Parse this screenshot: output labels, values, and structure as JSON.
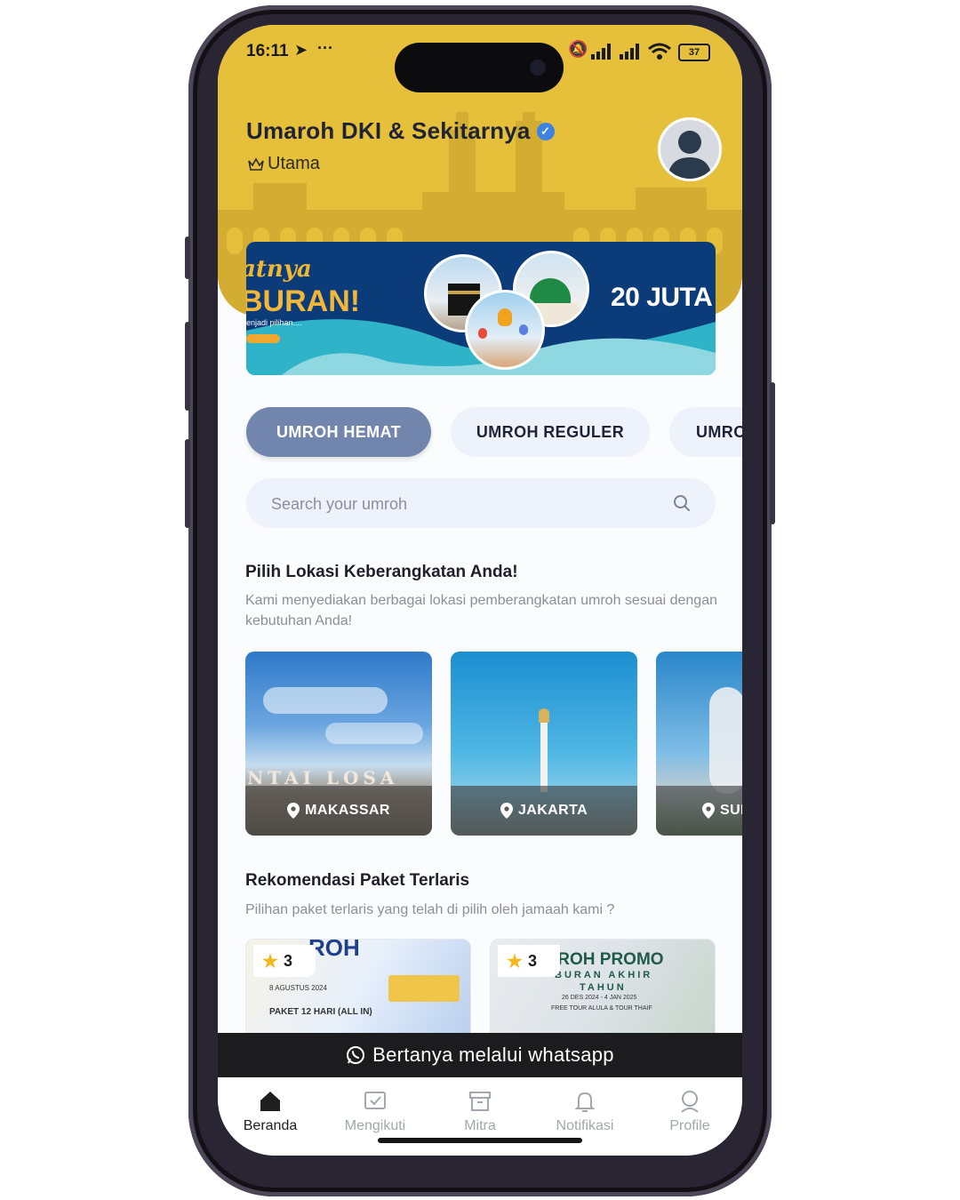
{
  "status_bar": {
    "time": "16:11",
    "battery": "37"
  },
  "header": {
    "title": "Umaroh DKI & Sekitarnya",
    "tier": "Utama"
  },
  "banner": {
    "left_script": "atnya",
    "left_big": "BURAN!",
    "left_small": "enjadi pilihan....",
    "right_text": "20 JUTA"
  },
  "tabs": [
    {
      "label": "UMROH HEMAT",
      "active": true
    },
    {
      "label": "UMROH REGULER",
      "active": false
    },
    {
      "label": "UMRO",
      "active": false
    }
  ],
  "search": {
    "placeholder": "Search your umroh"
  },
  "locations_section": {
    "title": "Pilih Lokasi Keberangkatan Anda!",
    "subtitle": "Kami menyediakan berbagai lokasi pemberangkatan umroh sesuai dengan kebutuhan Anda!",
    "items": [
      {
        "name": "MAKASSAR",
        "sign": "NTAI LOSA"
      },
      {
        "name": "JAKARTA"
      },
      {
        "name": "SUI"
      }
    ]
  },
  "packages_section": {
    "title": "Rekomendasi Paket Terlaris",
    "subtitle": "Pilihan paket terlaris yang telah di pilih oleh jamaah kami ?",
    "items": [
      {
        "rating": "3",
        "poster_title": "ROH",
        "poster_line1": "PAKET 12 HARI (ALL IN)",
        "poster_date": "8 AGUSTUS 2024"
      },
      {
        "rating": "3",
        "poster_title": "IROH PROMO",
        "poster_line1": "BURAN AKHIR",
        "poster_line2": "TAHUN",
        "poster_date": "26 DES 2024 - 4 JAN 2025",
        "poster_line3": "FREE TOUR ALULA & TOUR THAIF"
      }
    ]
  },
  "whatsapp_bar": {
    "label": "Bertanya melalui whatsapp"
  },
  "bottom_nav": [
    {
      "label": "Beranda",
      "icon": "home-icon",
      "active": true
    },
    {
      "label": "Mengikuti",
      "icon": "checkbox-icon",
      "active": false
    },
    {
      "label": "Mitra",
      "icon": "archive-icon",
      "active": false
    },
    {
      "label": "Notifikasi",
      "icon": "bell-icon",
      "active": false
    },
    {
      "label": "Profile",
      "icon": "user-icon",
      "active": false
    }
  ],
  "colors": {
    "header": "#e7c03b",
    "tab_active": "#7185ad",
    "tab_inactive": "#eef2fb"
  }
}
